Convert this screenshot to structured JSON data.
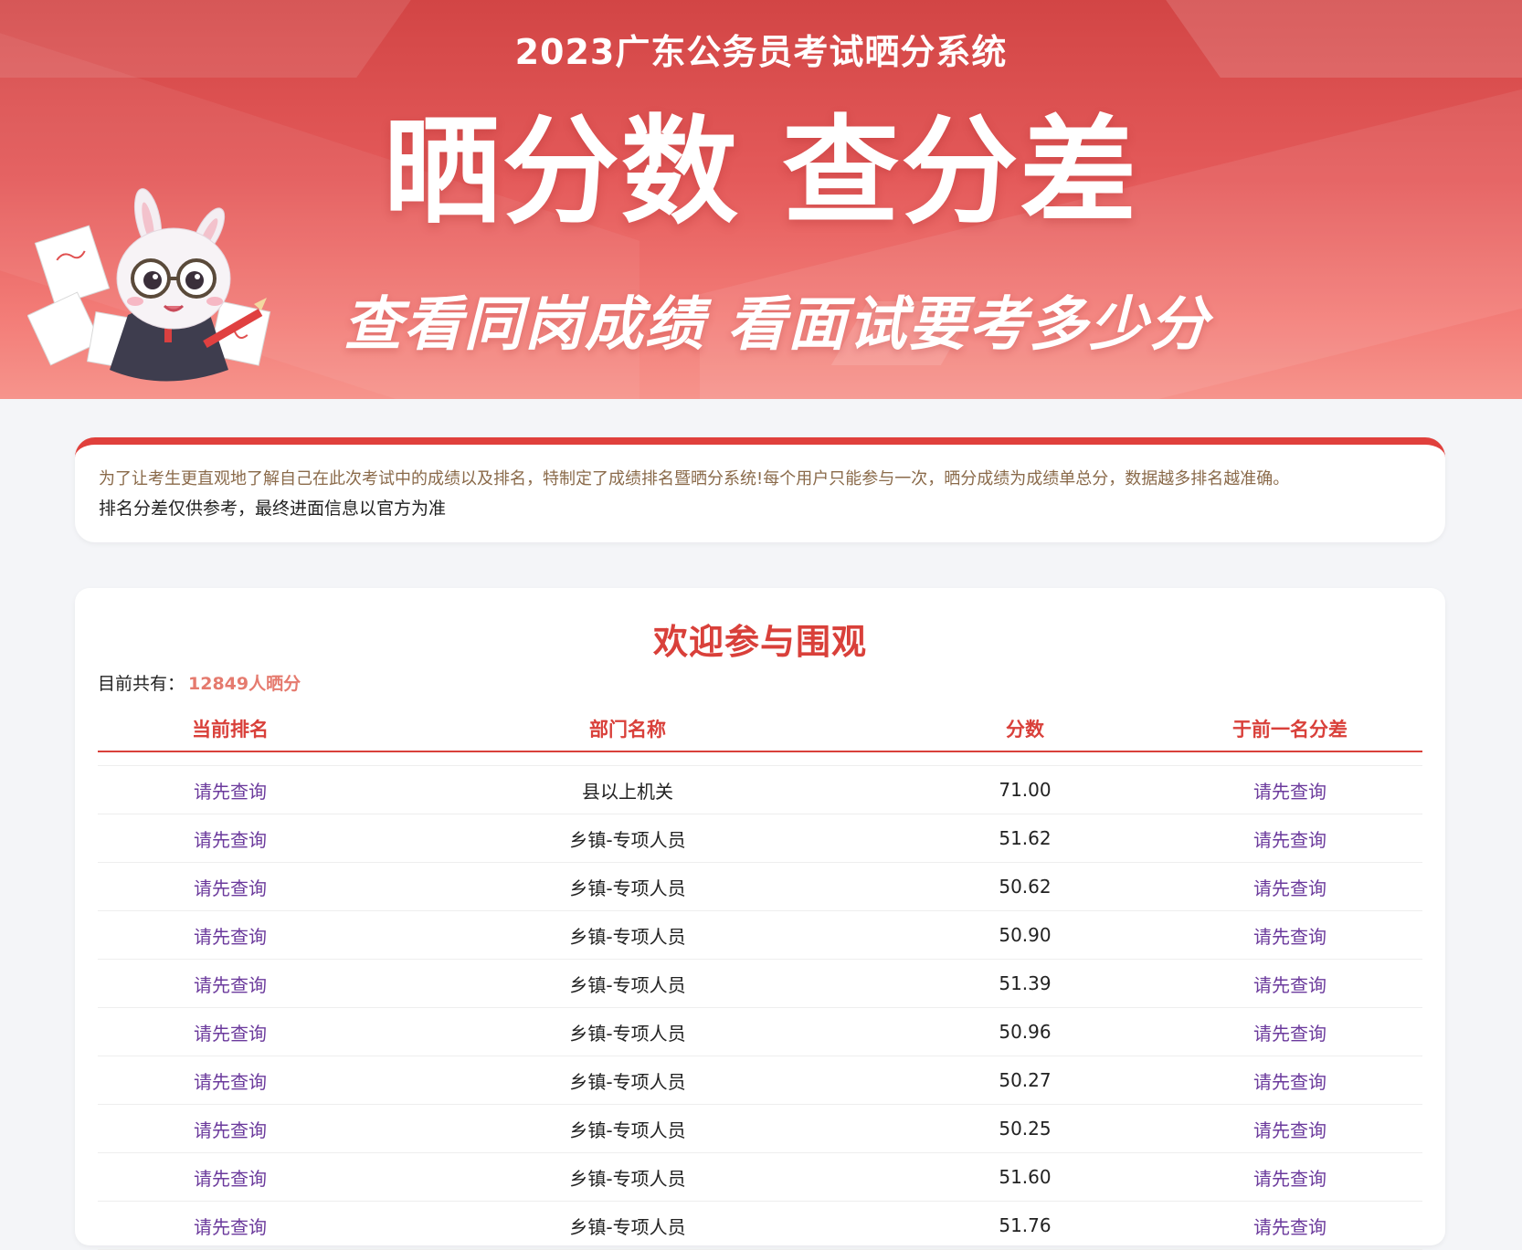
{
  "banner": {
    "title": "2023广东公务员考试晒分系统",
    "slogan": "晒分数 查分差",
    "subtitle": "查看同岗成绩 看面试要考多少分"
  },
  "notice": {
    "line1": "为了让考生更直观地了解自己在此次考试中的成绩以及排名，特制定了成绩排名暨晒分系统!每个用户只能参与一次，晒分成绩为成绩单总分，数据越多排名越准确。",
    "line2": "排名分差仅供参考，最终进面信息以官方为准"
  },
  "main": {
    "heading": "欢迎参与围观",
    "count_label": "目前共有：",
    "count_value": "12849人晒分",
    "columns": [
      "当前排名",
      "部门名称",
      "分数",
      "于前一名分差"
    ],
    "rows": [
      {
        "rank": "请先查询",
        "dept": "县以上机关",
        "score": "71.00",
        "diff": "请先查询"
      },
      {
        "rank": "请先查询",
        "dept": "乡镇-专项人员",
        "score": "51.62",
        "diff": "请先查询"
      },
      {
        "rank": "请先查询",
        "dept": "乡镇-专项人员",
        "score": "50.62",
        "diff": "请先查询"
      },
      {
        "rank": "请先查询",
        "dept": "乡镇-专项人员",
        "score": "50.90",
        "diff": "请先查询"
      },
      {
        "rank": "请先查询",
        "dept": "乡镇-专项人员",
        "score": "51.39",
        "diff": "请先查询"
      },
      {
        "rank": "请先查询",
        "dept": "乡镇-专项人员",
        "score": "50.96",
        "diff": "请先查询"
      },
      {
        "rank": "请先查询",
        "dept": "乡镇-专项人员",
        "score": "50.27",
        "diff": "请先查询"
      },
      {
        "rank": "请先查询",
        "dept": "乡镇-专项人员",
        "score": "50.25",
        "diff": "请先查询"
      },
      {
        "rank": "请先查询",
        "dept": "乡镇-专项人员",
        "score": "51.60",
        "diff": "请先查询"
      },
      {
        "rank": "请先查询",
        "dept": "乡镇-专项人员",
        "score": "51.76",
        "diff": "请先查询"
      }
    ]
  },
  "colors": {
    "accent": "#d9403a",
    "link": "#6b3a9c",
    "count": "#e57a6e"
  },
  "icons": {
    "mascot": "rabbit-mascot-icon"
  }
}
